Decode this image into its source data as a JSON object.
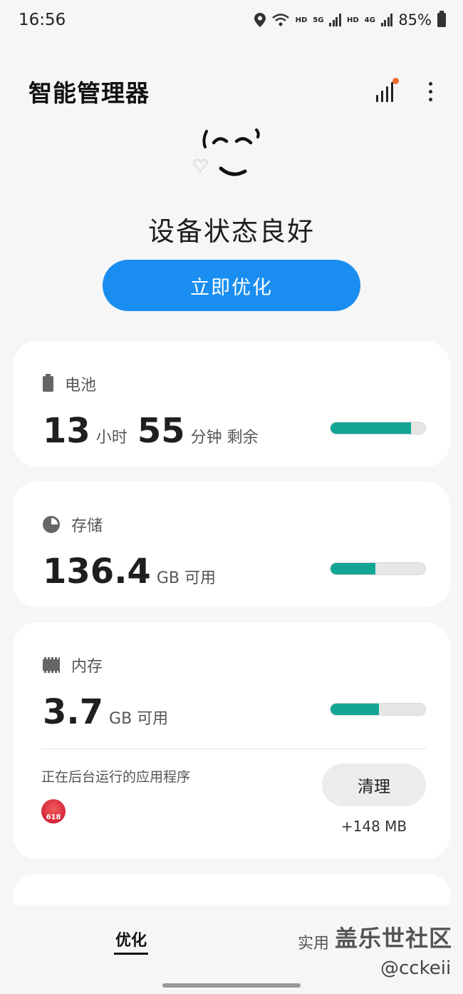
{
  "status_bar": {
    "time": "16:56",
    "hd1": "HD",
    "net1": "5G",
    "hd2": "HD",
    "net2": "4G",
    "battery": "85%"
  },
  "header": {
    "title": "智能管理器"
  },
  "hero": {
    "status": "设备状态良好",
    "optimize_label": "立即优化"
  },
  "battery_card": {
    "label": "电池",
    "hours": "13",
    "hours_unit": "小时",
    "minutes": "55",
    "minutes_unit": "分钟 剩余",
    "level": 0.85
  },
  "storage_card": {
    "label": "存储",
    "value": "136.4",
    "unit": "GB 可用",
    "used_fraction": 0.47
  },
  "memory_card": {
    "label": "内存",
    "value": "3.7",
    "unit": "GB 可用",
    "used_fraction": 0.51,
    "background_label": "正在后台运行的应用程序",
    "app_icon_text": "618",
    "clean_label": "清理",
    "freed": "+148 MB"
  },
  "bottom_nav": {
    "tab_optimize": "优化",
    "tab_tools": "实用",
    "watermark": "盖乐世社区",
    "watermark_user": "@cckeii"
  },
  "colors": {
    "accent": "#1a8ef0",
    "progress": "#12a594",
    "notification_dot": "#f06c2d"
  }
}
